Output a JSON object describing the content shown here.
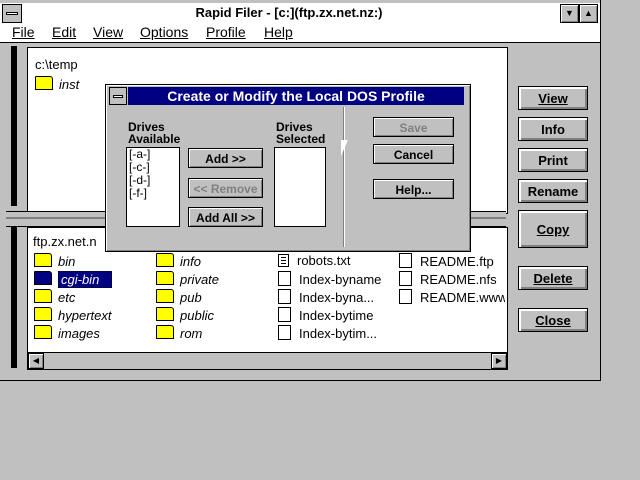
{
  "window": {
    "title": "Rapid Filer - [c:](ftp.zx.net.nz:)"
  },
  "menu": [
    {
      "label": "File"
    },
    {
      "label": "Edit"
    },
    {
      "label": "View"
    },
    {
      "label": "Options"
    },
    {
      "label": "Profile"
    },
    {
      "label": "Help"
    }
  ],
  "top_panel": {
    "path": "c:\\temp",
    "folders": [
      "inst"
    ]
  },
  "bottom_panel": {
    "path": "ftp.zx.net.n",
    "col1": [
      "bin",
      "cgi-bin",
      "etc",
      "hypertext",
      "images"
    ],
    "col2": [
      "info",
      "private",
      "pub",
      "public",
      "rom"
    ],
    "col3": [
      "robots.txt",
      "Index-byname",
      "Index-byna...",
      "Index-bytime",
      "Index-bytim..."
    ],
    "col4": [
      "README.ftp",
      "README.nfs",
      "README.www"
    ],
    "selected": "cgi-bin"
  },
  "side_buttons": [
    "View",
    "Info",
    "Print",
    "Rename",
    "Copy",
    "Delete",
    "Close"
  ],
  "dialog": {
    "title": "Create or Modify the Local DOS Profile",
    "available_label_1": "Drives",
    "available_label_2": "Available",
    "selected_label_1": "Drives",
    "selected_label_2": "Selected",
    "drives_available": [
      "[-a-]",
      "[-c-]",
      "[-d-]",
      "[-f-]"
    ],
    "add": "Add >>",
    "remove": "<< Remove",
    "add_all": "Add All >>",
    "save": "Save",
    "cancel": "Cancel",
    "help": "Help..."
  }
}
